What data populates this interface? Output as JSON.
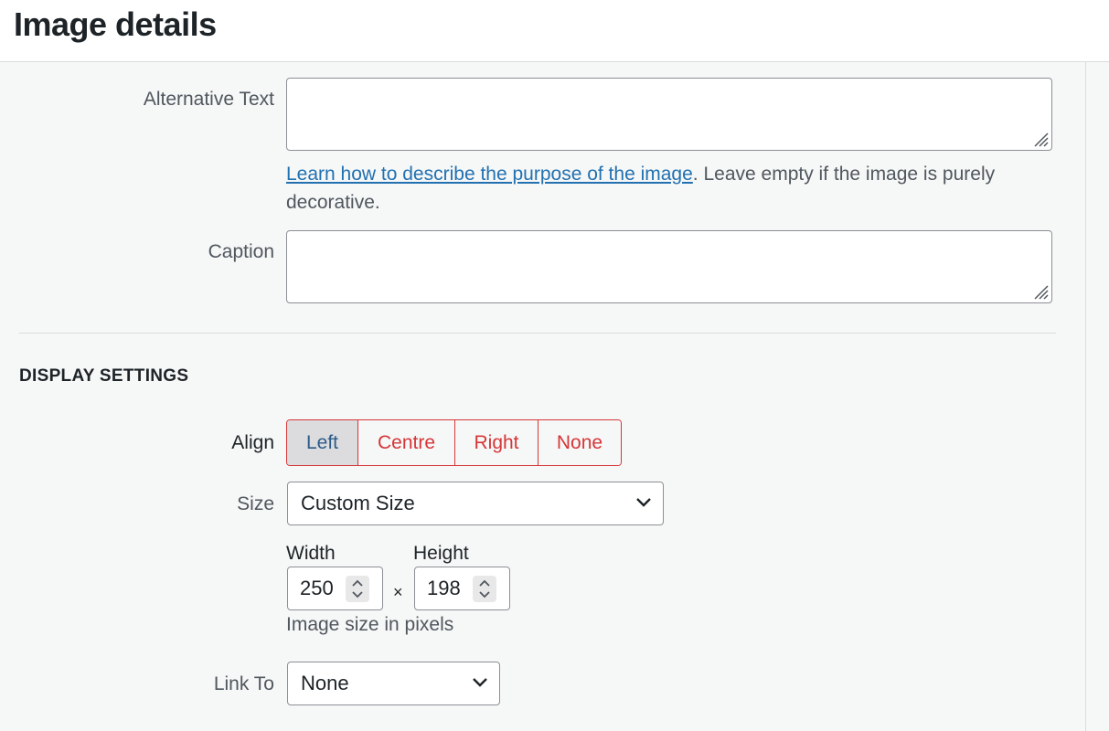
{
  "header": {
    "title": "Image details"
  },
  "alt_text": {
    "label": "Alternative Text",
    "value": "",
    "help_link": "Learn how to describe the purpose of the image",
    "help_rest": ". Leave empty if the image is purely decorative."
  },
  "caption": {
    "label": "Caption",
    "value": ""
  },
  "display": {
    "title": "DISPLAY SETTINGS",
    "align": {
      "label": "Align",
      "options": [
        "Left",
        "Centre",
        "Right",
        "None"
      ],
      "selected": "Left"
    },
    "size": {
      "label": "Size",
      "value": "Custom Size"
    },
    "width": {
      "label": "Width",
      "value": "250"
    },
    "height": {
      "label": "Height",
      "value": "198"
    },
    "times": "×",
    "size_hint": "Image size in pixels",
    "link_to": {
      "label": "Link To",
      "value": "None"
    }
  },
  "colors": {
    "accent_red": "#d63638",
    "link_blue": "#2271b1"
  },
  "icons": [
    "resize-grip-icon",
    "chevron-down-icon",
    "spinner-arrows-icon"
  ]
}
